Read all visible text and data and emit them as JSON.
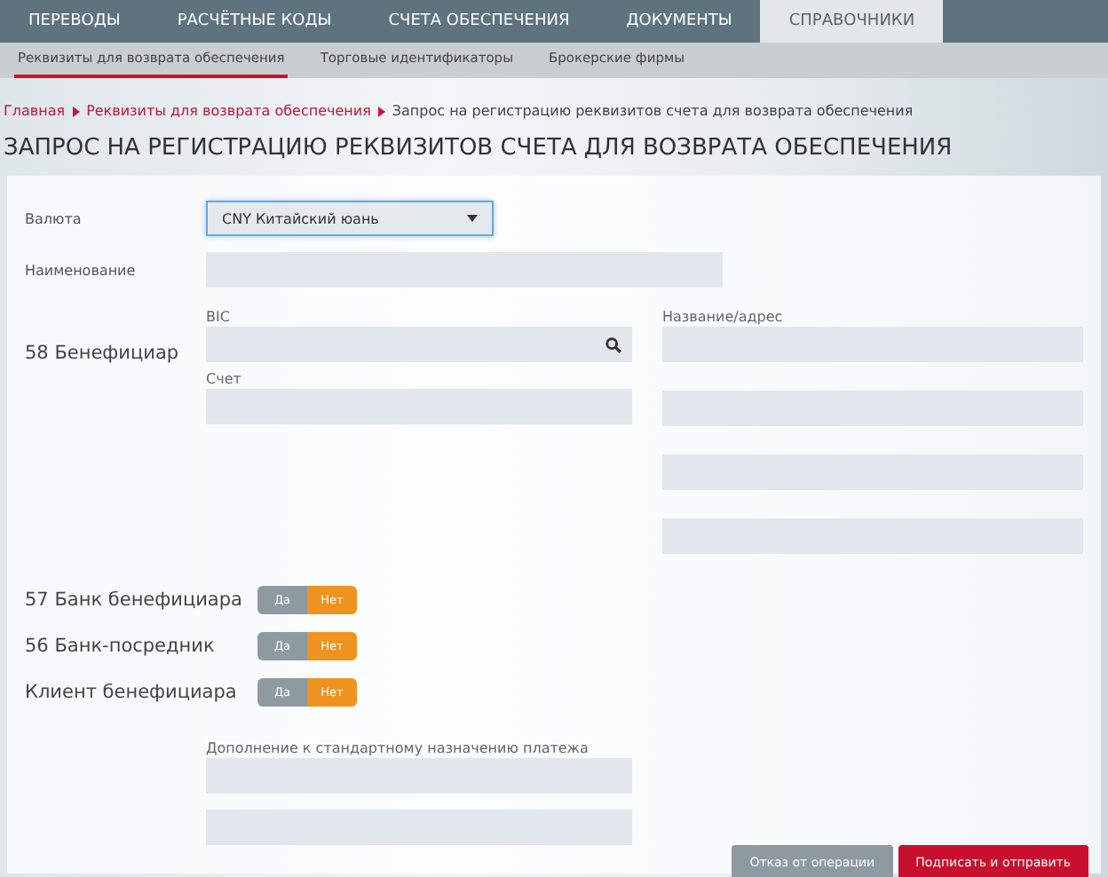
{
  "nav": {
    "tabs": [
      {
        "label": "ПЕРЕВОДЫ",
        "selected": false
      },
      {
        "label": "РАСЧЁТНЫЕ КОДЫ",
        "selected": false
      },
      {
        "label": "СЧЕТА ОБЕСПЕЧЕНИЯ",
        "selected": false
      },
      {
        "label": "ДОКУМЕНТЫ",
        "selected": false
      },
      {
        "label": "СПРАВОЧНИКИ",
        "selected": true
      }
    ]
  },
  "subnav": {
    "tabs": [
      {
        "label": "Реквизиты для возврата обеспечения",
        "selected": true
      },
      {
        "label": "Торговые идентификаторы",
        "selected": false
      },
      {
        "label": "Брокерские фирмы",
        "selected": false
      }
    ]
  },
  "breadcrumb": [
    {
      "label": "Главная",
      "current": false
    },
    {
      "label": "Реквизиты для возврата обеспечения",
      "current": false
    },
    {
      "label": "Запрос на регистрацию реквизитов счета для возврата обеспечения",
      "current": true
    }
  ],
  "title": "ЗАПРОС НА РЕГИСТРАЦИЮ РЕКВИЗИТОВ СЧЕТА ДЛЯ ВОЗВРАТА ОБЕСПЕЧЕНИЯ",
  "form": {
    "currency": {
      "label": "Валюта",
      "value": "CNY Китайский юань"
    },
    "name": {
      "label": "Наименование"
    },
    "beneficiary": {
      "title": "58 Бенефициар",
      "bic_label": "BIC",
      "account_label": "Счет",
      "name_address_label": "Название/адрес"
    },
    "toggles": [
      {
        "label": "57 Банк бенефициара",
        "options": [
          {
            "label": "Да",
            "selected": false
          },
          {
            "label": "Нет",
            "selected": true
          }
        ]
      },
      {
        "label": "56 Банк-посредник",
        "options": [
          {
            "label": "Да",
            "selected": false
          },
          {
            "label": "Нет",
            "selected": true
          }
        ]
      },
      {
        "label": "Клиент бенефициара",
        "options": [
          {
            "label": "Да",
            "selected": false
          },
          {
            "label": "Нет",
            "selected": true
          }
        ]
      }
    ],
    "purpose": {
      "label": "Дополнение к стандартному назначению платежа"
    }
  },
  "buttons": [
    {
      "label": "Отказ от операции",
      "kind": "secondary"
    },
    {
      "label": "Подписать и отправить",
      "kind": "primary"
    }
  ]
}
